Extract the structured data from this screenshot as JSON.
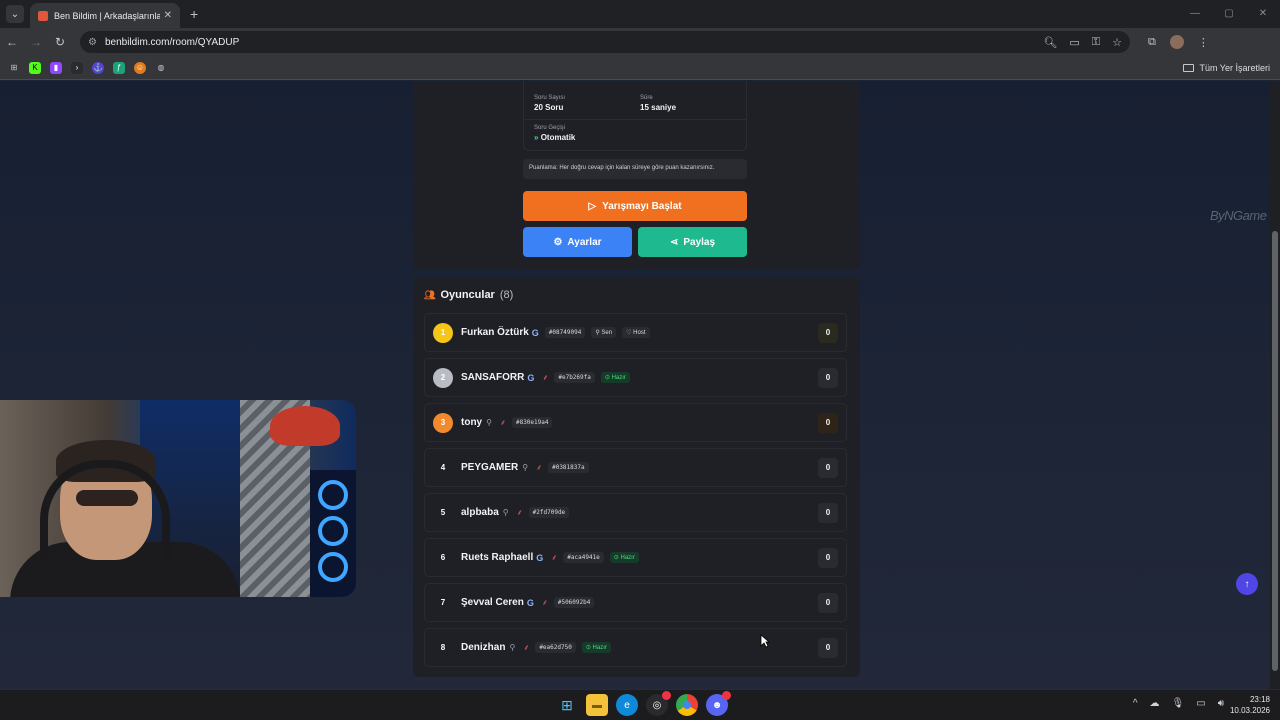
{
  "browser": {
    "tab_title": "Ben Bildim | Arkadaşlarınla Onli",
    "tab_close": "✕",
    "new_tab": "+",
    "url": "benbildim.com/room/QYADUP",
    "bookmarks_all": "Tüm Yer İşaretleri"
  },
  "room": {
    "info": {
      "question_count_label": "Soru Sayısı",
      "question_count_value": "20 Soru",
      "duration_label": "Süre",
      "duration_value": "15 saniye",
      "transition_label": "Soru Geçişi",
      "transition_value": "Otomatik"
    },
    "scoring_note": "Puanlama: Her doğru cevap için kalan süreye göre puan kazanırsınız.",
    "start_label": "Yarışmayı Başlat",
    "settings_label": "Ayarlar",
    "share_label": "Paylaş"
  },
  "watermark": "ByNGame",
  "players": {
    "title": "Oyuncular",
    "count": "(8)",
    "you_label": "Sen",
    "host_label": "Host",
    "ready_label": "Hazır",
    "list": [
      {
        "rank": "1",
        "name": "Furkan Öztürk",
        "tag": "#08749094",
        "score": "0"
      },
      {
        "rank": "2",
        "name": "SANSAFORR",
        "tag": "#e7b269fa",
        "score": "0"
      },
      {
        "rank": "3",
        "name": "tony",
        "tag": "#830e19a4",
        "score": "0"
      },
      {
        "rank": "4",
        "name": "PEYGAMER",
        "tag": "#0381837a",
        "score": "0"
      },
      {
        "rank": "5",
        "name": "alpbaba",
        "tag": "#2fd709de",
        "score": "0"
      },
      {
        "rank": "6",
        "name": "Ruets Raphaell",
        "tag": "#aca4941e",
        "score": "0"
      },
      {
        "rank": "7",
        "name": "Şevval Ceren",
        "tag": "#506092b4",
        "score": "0"
      },
      {
        "rank": "8",
        "name": "Denizhan",
        "tag": "#ea62d750",
        "score": "0"
      }
    ]
  },
  "taskbar": {
    "time": "23:18",
    "date": "10.03.2026"
  },
  "colors": {
    "accent_orange": "#f07020",
    "settings_blue": "#3b82f6",
    "share_green": "#1fb98f",
    "ready_green": "#4ade80"
  }
}
